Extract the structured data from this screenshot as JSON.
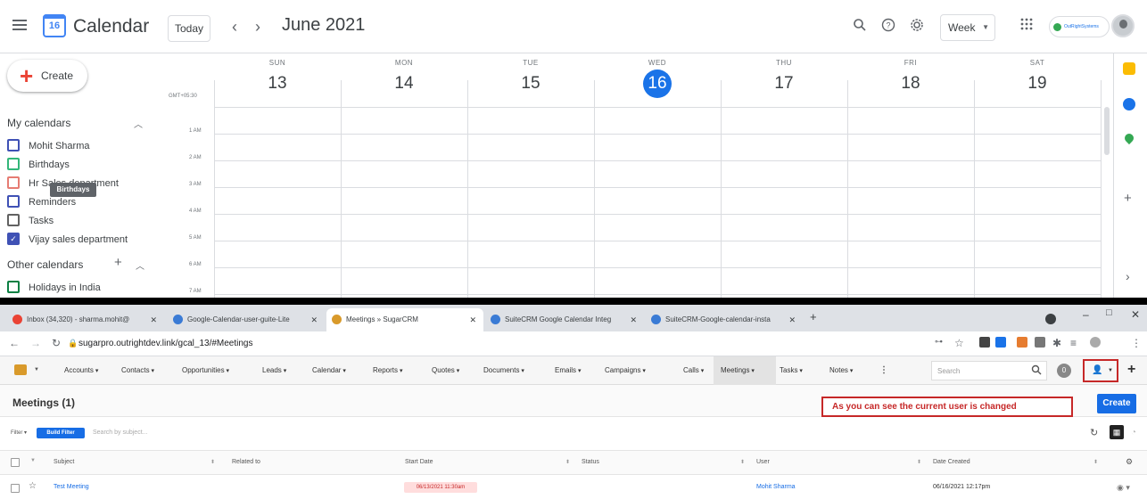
{
  "gcal": {
    "title": "Calendar",
    "logo_day": "16",
    "today": "Today",
    "prev": "‹",
    "next": "›",
    "month": "June 2021",
    "view": "Week",
    "org_logo_text": "OutRightSystems",
    "create": "Create",
    "tz": "GMT+05:30",
    "days": [
      {
        "name": "SUN",
        "num": "13"
      },
      {
        "name": "MON",
        "num": "14"
      },
      {
        "name": "TUE",
        "num": "15"
      },
      {
        "name": "WED",
        "num": "16",
        "today": true
      },
      {
        "name": "THU",
        "num": "17"
      },
      {
        "name": "FRI",
        "num": "18"
      },
      {
        "name": "SAT",
        "num": "19"
      }
    ],
    "hours": [
      "1 AM",
      "2 AM",
      "3 AM",
      "4 AM",
      "5 AM",
      "6 AM",
      "7 AM"
    ],
    "my_calendars": "My calendars",
    "calendars": [
      {
        "label": "Mohit Sharma",
        "color": "#3f51b5",
        "checked": false
      },
      {
        "label": "Birthdays",
        "color": "#33b679",
        "checked": false
      },
      {
        "label": "Hr Sales department",
        "color": "#e67c73",
        "checked": false
      },
      {
        "label": "Reminders",
        "color": "#3f51b5",
        "checked": false
      },
      {
        "label": "Tasks",
        "color": "#616161",
        "checked": false
      },
      {
        "label": "Vijay sales department",
        "color": "#3f51b5",
        "checked": true
      }
    ],
    "tooltip": "Birthdays",
    "other_calendars": "Other calendars",
    "other": [
      {
        "label": "Holidays in India",
        "color": "#0b8043",
        "checked": false
      }
    ]
  },
  "chrome": {
    "tabs": [
      {
        "label": "Inbox (34,320) - sharma.mohit@",
        "icon": "gmail-icon",
        "color": "#ea4335"
      },
      {
        "label": "Google-Calendar-user-guite-Lite",
        "icon": "doc-icon",
        "color": "#3a7bd5"
      },
      {
        "label": "Meetings » SugarCRM",
        "icon": "sugar-icon",
        "color": "#d99a2b",
        "active": true
      },
      {
        "label": "SuiteCRM Google Calendar Integ",
        "icon": "doc-icon",
        "color": "#3a7bd5"
      },
      {
        "label": "SuiteCRM-Google-calendar-insta",
        "icon": "doc-icon",
        "color": "#3a7bd5"
      }
    ],
    "new_tab": "+",
    "url": "sugarpro.outrightdev.link/gcal_13/#Meetings"
  },
  "crm": {
    "nav": [
      "Accounts",
      "Contacts",
      "Opportunities",
      "Leads",
      "Calendar",
      "Reports",
      "Quotes",
      "Documents",
      "Emails",
      "Campaigns",
      "Calls",
      "Meetings",
      "Tasks",
      "Notes"
    ],
    "search_placeholder": "Search",
    "notifications": "0",
    "page_title": "Meetings (1)",
    "note": "As you can see the current user is changed",
    "create": "Create",
    "filter": "Filter",
    "build_filter": "Build Filter",
    "filter_placeholder": "Search by subject...",
    "columns": [
      "Subject",
      "Related to",
      "Start Date",
      "Status",
      "User",
      "Date Created"
    ],
    "rows": [
      {
        "subject": "Test Meeting",
        "related": "",
        "start": "06/13/2021 11:30am",
        "status": "",
        "user": "Mohit Sharma",
        "created": "06/16/2021 12:17pm"
      }
    ]
  }
}
